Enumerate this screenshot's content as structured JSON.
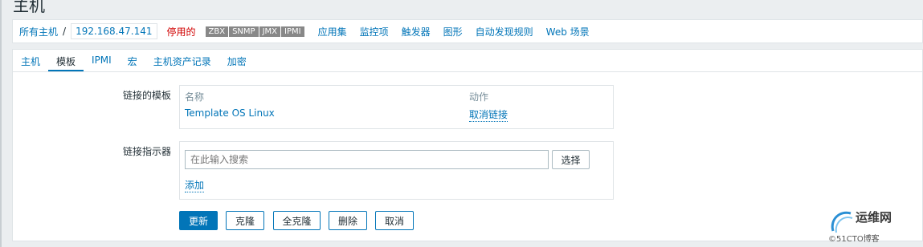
{
  "page": {
    "title": "主机"
  },
  "breadcrumb": {
    "all_hosts": "所有主机",
    "separator": "/",
    "host": "192.168.47.141",
    "status": "停用的",
    "badges": [
      "ZBX",
      "SNMP",
      "JMX",
      "IPMI"
    ],
    "links": [
      "应用集",
      "监控项",
      "触发器",
      "图形",
      "自动发现规则",
      "Web 场景"
    ]
  },
  "tabs": [
    "主机",
    "模板",
    "IPMI",
    "宏",
    "主机资产记录",
    "加密"
  ],
  "active_tab": "模板",
  "linked_templates": {
    "label": "链接的模板",
    "col_name": "名称",
    "col_action": "动作",
    "rows": [
      {
        "name": "Template OS Linux",
        "action": "取消链接"
      }
    ]
  },
  "link_new": {
    "label": "链接指示器",
    "placeholder": "在此输入搜索",
    "select_label": "选择",
    "add_label": "添加"
  },
  "buttons": {
    "update": "更新",
    "clone": "克隆",
    "full_clone": "全克隆",
    "delete": "删除",
    "cancel": "取消"
  },
  "watermark": {
    "text": "运维网",
    "sub": "©51CTO博客"
  },
  "colors": {
    "link": "#0275b8",
    "status_disabled": "#d00000",
    "badge": "#888888"
  }
}
